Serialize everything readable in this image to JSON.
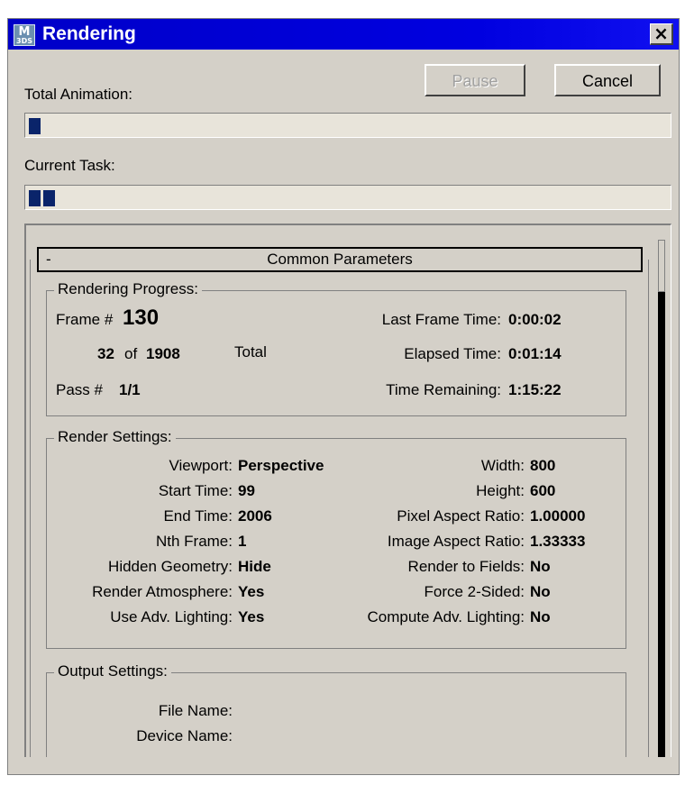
{
  "window": {
    "title": "Rendering",
    "close": "×"
  },
  "app_icon": {
    "line1": "M",
    "line2": "3DS"
  },
  "buttons": {
    "pause": "Pause",
    "cancel": "Cancel"
  },
  "total_animation": {
    "label": "Total Animation:",
    "progress_fraction": 0.017
  },
  "current_task": {
    "label": "Current Task:",
    "progress_fraction": 0.06
  },
  "rollout": {
    "minus": "-",
    "title": "Common Parameters"
  },
  "rendering_progress": {
    "title": "Rendering Progress:",
    "frame_label": "Frame #",
    "frame_value": "130",
    "count_current": "32",
    "count_of": "of",
    "count_total": "1908",
    "total_label": "Total",
    "pass_label": "Pass #",
    "pass_value": "1/1",
    "last_frame_time_label": "Last Frame Time:",
    "last_frame_time_value": "0:00:02",
    "elapsed_label": "Elapsed Time:",
    "elapsed_value": "0:01:14",
    "remaining_label": "Time Remaining:",
    "remaining_value": "1:15:22"
  },
  "render_settings": {
    "title": "Render Settings:",
    "left": [
      {
        "label": "Viewport:",
        "value": "Perspective"
      },
      {
        "label": "Start Time:",
        "value": "99"
      },
      {
        "label": "End Time:",
        "value": "2006"
      },
      {
        "label": "Nth Frame:",
        "value": "1"
      },
      {
        "label": "Hidden Geometry:",
        "value": "Hide"
      },
      {
        "label": "Render Atmosphere:",
        "value": "Yes"
      },
      {
        "label": "Use Adv. Lighting:",
        "value": "Yes"
      }
    ],
    "right": [
      {
        "label": "Width:",
        "value": "800"
      },
      {
        "label": "Height:",
        "value": "600"
      },
      {
        "label": "Pixel Aspect Ratio:",
        "value": "1.00000"
      },
      {
        "label": "Image Aspect Ratio:",
        "value": "1.33333"
      },
      {
        "label": "Render to Fields:",
        "value": "No"
      },
      {
        "label": "Force 2-Sided:",
        "value": "No"
      },
      {
        "label": "Compute Adv. Lighting:",
        "value": "No"
      }
    ]
  },
  "output_settings": {
    "title": "Output Settings:",
    "file_name_label": "File Name:",
    "device_name_label": "Device Name:"
  }
}
